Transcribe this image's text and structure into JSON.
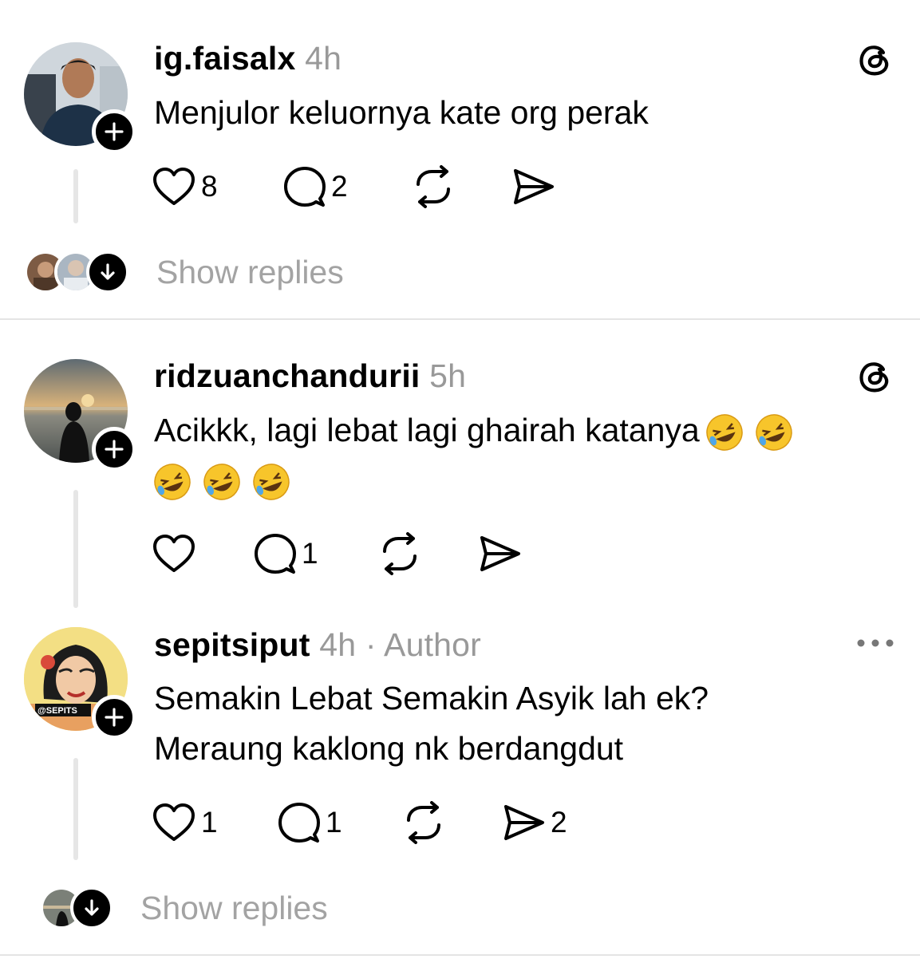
{
  "posts": [
    {
      "username": "ig.faisalx",
      "time": "4h",
      "text": "Menjulor keluornya kate org perak",
      "likes": "8",
      "comments": "2",
      "show_replies": "Show replies"
    },
    {
      "username": "ridzuanchandurii",
      "time": "5h",
      "text_line1": "Acikkk, lagi lebat lagi ghairah katanya",
      "likes": "",
      "comments": "1"
    },
    {
      "username": "sepitsiput",
      "time": "4h",
      "author_tag": "· Author",
      "text_line1": "Semakin Lebat Semakin Asyik lah ek?",
      "text_line2": "Meraung kaklong nk berdangdut",
      "likes": "1",
      "comments": "1",
      "shares": "2",
      "avatar_watermark": "@SEPITS",
      "show_replies": "Show replies"
    }
  ],
  "icons": {
    "threads": "threads-logo-icon",
    "like": "heart-icon",
    "comment": "comment-bubble-icon",
    "repost": "repost-icon",
    "share": "send-icon",
    "more": "more-options-icon",
    "follow": "plus-icon",
    "expand": "arrow-down-icon",
    "emoji": "rolling-on-floor-laughing-emoji"
  }
}
